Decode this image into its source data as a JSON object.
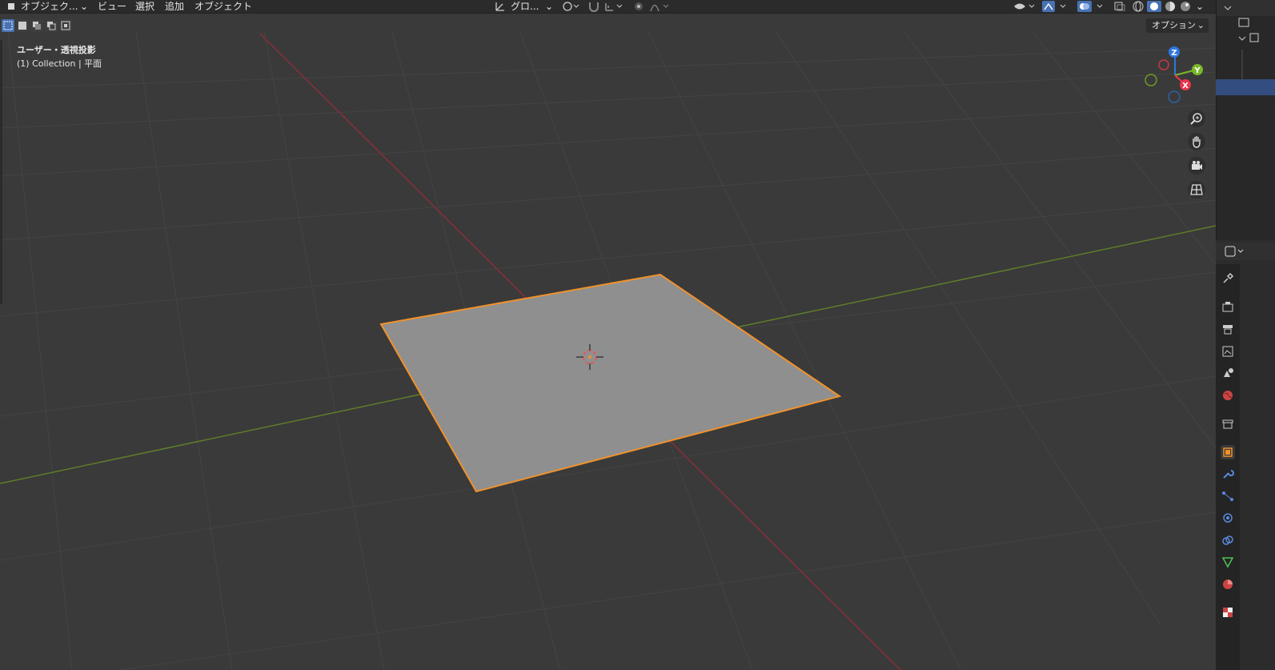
{
  "header": {
    "mode_label": "オブジェク...",
    "menu": {
      "view": "ビュー",
      "select": "選択",
      "add": "追加",
      "object": "オブジェクト"
    },
    "transform_orientation": "グロ...",
    "options_label": "オプション"
  },
  "viewport": {
    "view_name": "ユーザー・透視投影",
    "collection_label": "(1) Collection | 平面"
  },
  "gizmo": {
    "x_label": "X",
    "y_label": "Y",
    "z_label": "Z"
  },
  "colors": {
    "accent": "#4772b3",
    "selection_outline": "#f0922b",
    "x_axis": "#e8354d",
    "y_axis": "#7ab828",
    "z_axis": "#2d77e0"
  }
}
